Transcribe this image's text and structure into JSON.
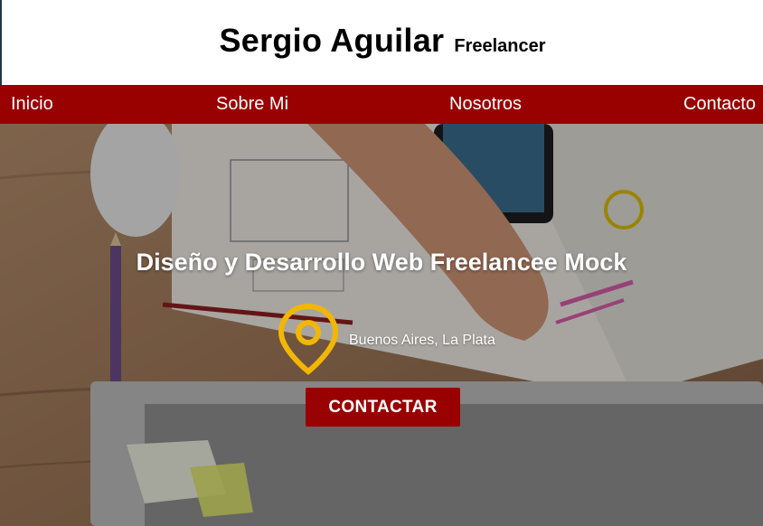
{
  "header": {
    "name": "Sergio Aguilar",
    "tagline": "Freelancer"
  },
  "nav": {
    "items": [
      {
        "label": "Inicio"
      },
      {
        "label": "Sobre Mi"
      },
      {
        "label": "Nosotros"
      },
      {
        "label": "Contacto"
      }
    ]
  },
  "hero": {
    "title": "Diseño y Desarrollo Web Freelancee Mock",
    "location": "Buenos Aires, La Plata",
    "cta_label": "CONTACTAR",
    "location_icon": "map-pin-icon"
  },
  "colors": {
    "brand": "#990000",
    "pin": "#f2b705"
  }
}
